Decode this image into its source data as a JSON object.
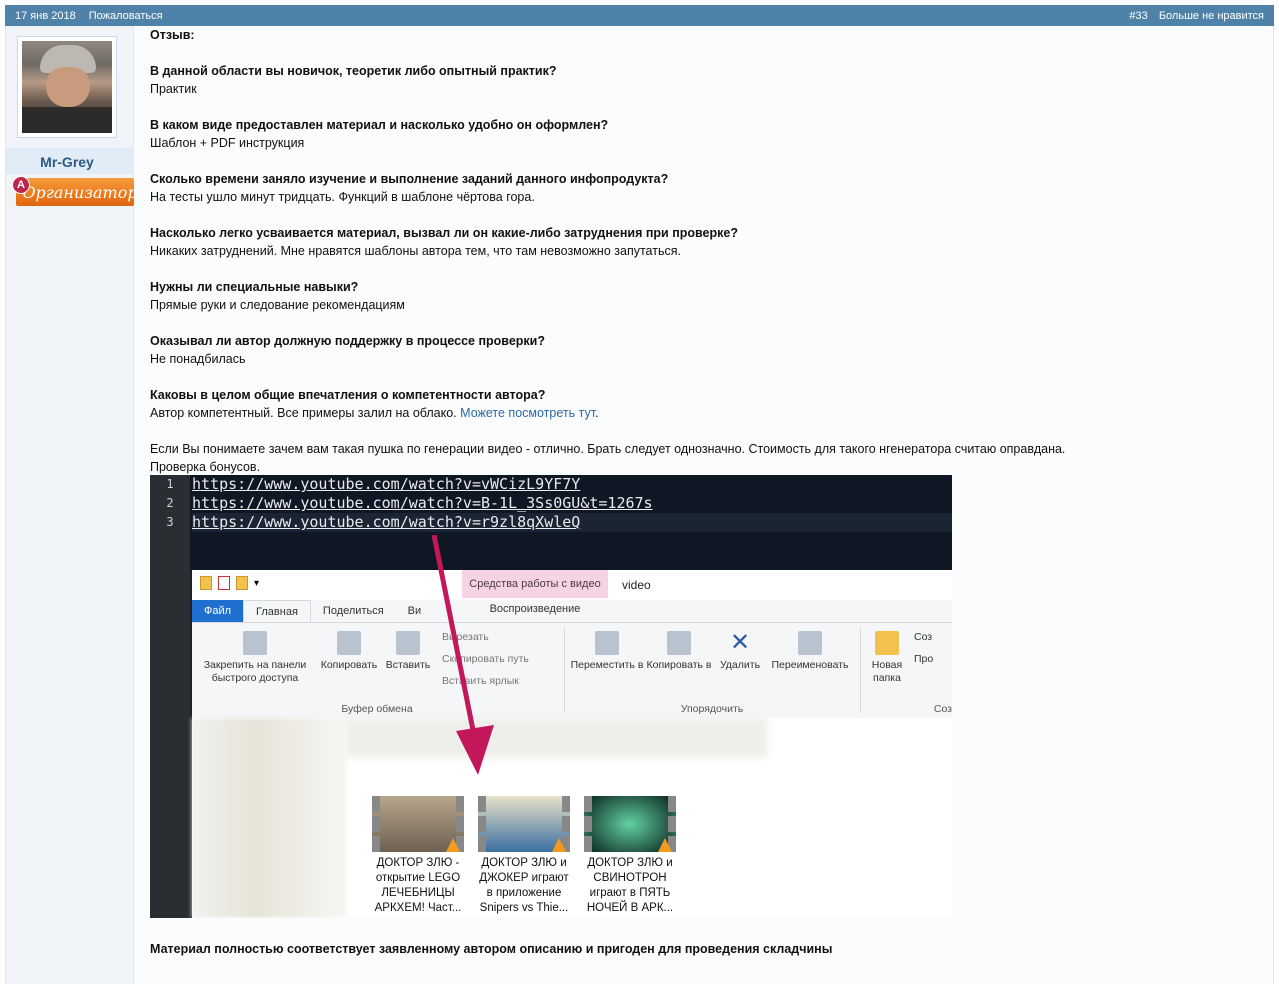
{
  "topbar": {
    "date": "17 янв 2018",
    "report": "Пожаловаться",
    "post_num": "#33",
    "unlike": "Больше не нравится"
  },
  "user": {
    "name": "Mr-Grey",
    "badge_letter": "A",
    "badge_title": "Организатор"
  },
  "review": {
    "heading": "Отзыв:",
    "qa": [
      {
        "q": "В данной области вы новичок, теоретик либо опытный практик?",
        "a": "Практик"
      },
      {
        "q": "В каком виде предоставлен материал и насколько удобно он оформлен?",
        "a": "Шаблон + PDF инструкция"
      },
      {
        "q": "Сколько времени заняло изучение и выполнение заданий данного инфопродукта?",
        "a": "На тесты ушло минут тридцать. Функций в шаблоне чёртова гора."
      },
      {
        "q": "Насколько легко усваивается материал, вызвал ли он какие-либо затруднения при проверке?",
        "a": "Никаких затруднений. Мне нравятся шаблоны автора тем, что там невозможно запутаться."
      },
      {
        "q": "Нужны ли специальные навыки?",
        "a": "Прямые руки и следование рекомендациям"
      },
      {
        "q": "Оказывал ли автор должную поддержку в процессе проверки?",
        "a": "Не понадбилась"
      }
    ],
    "last_q": "Каковы в целом общие впечатления о компетентности автора?",
    "last_a": "Автор компетентный. Все примеры залил на облако.",
    "last_link": "Можете посмотреть тут",
    "last_period": ".",
    "para": "Если Вы понимаете зачем вам такая пушка по генерации видео - отлично. Брать следует однозначно. Стоимость для такого нгенератора считаю оправдана.",
    "para2": "Проверка бонусов.",
    "final": "Материал полностью соответствует заявленному автором описанию и пригоден для проведения складчины"
  },
  "screenshot": {
    "lines": [
      "1",
      "2",
      "3"
    ],
    "urls": [
      "https://www.youtube.com/watch?v=vWCizL9YF7Y",
      "https://www.youtube.com/watch?v=B-1L_3Ss0GU&t=1267s",
      "https://www.youtube.com/watch?v=r9zl8qXwleQ"
    ],
    "ctx_tab": "Средства работы с видео",
    "ctx_sub": "Воспроизведение",
    "window_title": "video",
    "tabs": [
      "Файл",
      "Главная",
      "Поделиться",
      "Ви"
    ],
    "buttons": {
      "pin": "Закрепить на панели быстрого доступа",
      "copy": "Копировать",
      "paste": "Вставить",
      "cut": "Вырезать",
      "copy_path": "Скопировать путь",
      "paste_shortcut": "Вставить ярлык",
      "move": "Переместить в",
      "copy_to": "Копировать в",
      "delete": "Удалить",
      "rename": "Переименовать",
      "new_folder": "Новая папка",
      "create1": "Соз",
      "create2": "Про"
    },
    "groups": {
      "clipboard": "Буфер обмена",
      "organize": "Упорядочить",
      "create": "Соз"
    },
    "thumbs": [
      {
        "l1": "ДОКТОР ЗЛЮ -",
        "l2": "открытие LEGO",
        "l3": "ЛЕЧЕБНИЦЫ",
        "l4": "АРКХЕМ! Част..."
      },
      {
        "l1": "ДОКТОР ЗЛЮ и",
        "l2": "ДЖОКЕР играют",
        "l3": "в приложение",
        "l4": "Snipers vs Thie..."
      },
      {
        "l1": "ДОКТОР ЗЛЮ и",
        "l2": "СВИНОТРОН",
        "l3": "играют в ПЯТЬ",
        "l4": "НОЧЕЙ В АРК..."
      }
    ]
  }
}
